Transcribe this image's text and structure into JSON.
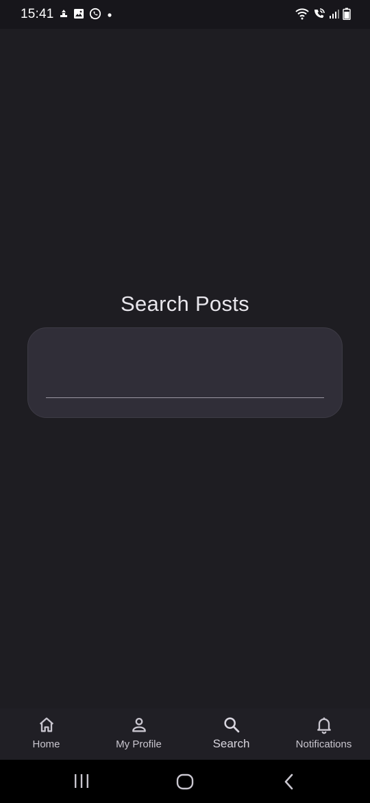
{
  "status_bar": {
    "time": "15:41",
    "left_icons": [
      "cloud-upload-icon",
      "gallery-icon",
      "whatsapp-icon",
      "dot-icon"
    ],
    "right_icons": [
      "wifi-icon",
      "wifi-calling-icon",
      "signal-icon",
      "battery-icon"
    ]
  },
  "main": {
    "title": "Search Posts",
    "search": {
      "value": "",
      "placeholder": ""
    }
  },
  "bottom_nav": {
    "items": [
      {
        "label": "Home",
        "icon": "home-icon",
        "active": false
      },
      {
        "label": "My Profile",
        "icon": "person-icon",
        "active": false
      },
      {
        "label": "Search",
        "icon": "search-icon",
        "active": true
      },
      {
        "label": "Notifications",
        "icon": "bell-icon",
        "active": false
      }
    ]
  },
  "system_nav": {
    "buttons": [
      "recent-apps-icon",
      "home-circle-icon",
      "back-icon"
    ]
  },
  "colors": {
    "background": "#1e1d22",
    "status_bar": "#17161b",
    "card": "#302e38",
    "text": "#e8e6ec",
    "nav_text": "#c9c6cf"
  }
}
